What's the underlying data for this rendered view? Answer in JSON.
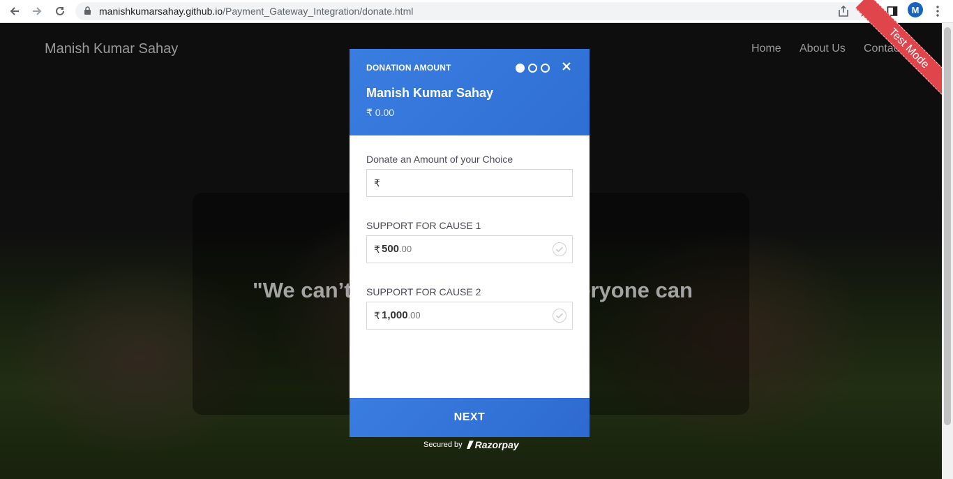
{
  "browser": {
    "url_host": "manishkumarsahay.github.io",
    "url_path": "/Payment_Gateway_Integration/donate.html",
    "avatar_letter": "M"
  },
  "site": {
    "brand": "Manish Kumar Sahay",
    "nav": [
      "Home",
      "About Us",
      "Contact Us"
    ],
    "quote": "\"We can’t help everyone, but everyone can",
    "ribbon": "Test Mode"
  },
  "modal": {
    "header_label": "DONATION AMOUNT",
    "title": "Manish Kumar Sahay",
    "amount": "₹ 0.00",
    "step": 1,
    "total_steps": 3,
    "custom_label": "Donate an Amount of your Choice",
    "currency_symbol": "₹",
    "custom_value": "",
    "options": [
      {
        "label": "SUPPORT FOR CAUSE 1",
        "amount": "500",
        "decimals": ".00"
      },
      {
        "label": "SUPPORT FOR CAUSE 2",
        "amount": "1,000",
        "decimals": ".00"
      }
    ],
    "next_label": "NEXT",
    "secured_by": "Secured by",
    "provider": "Razorpay"
  }
}
